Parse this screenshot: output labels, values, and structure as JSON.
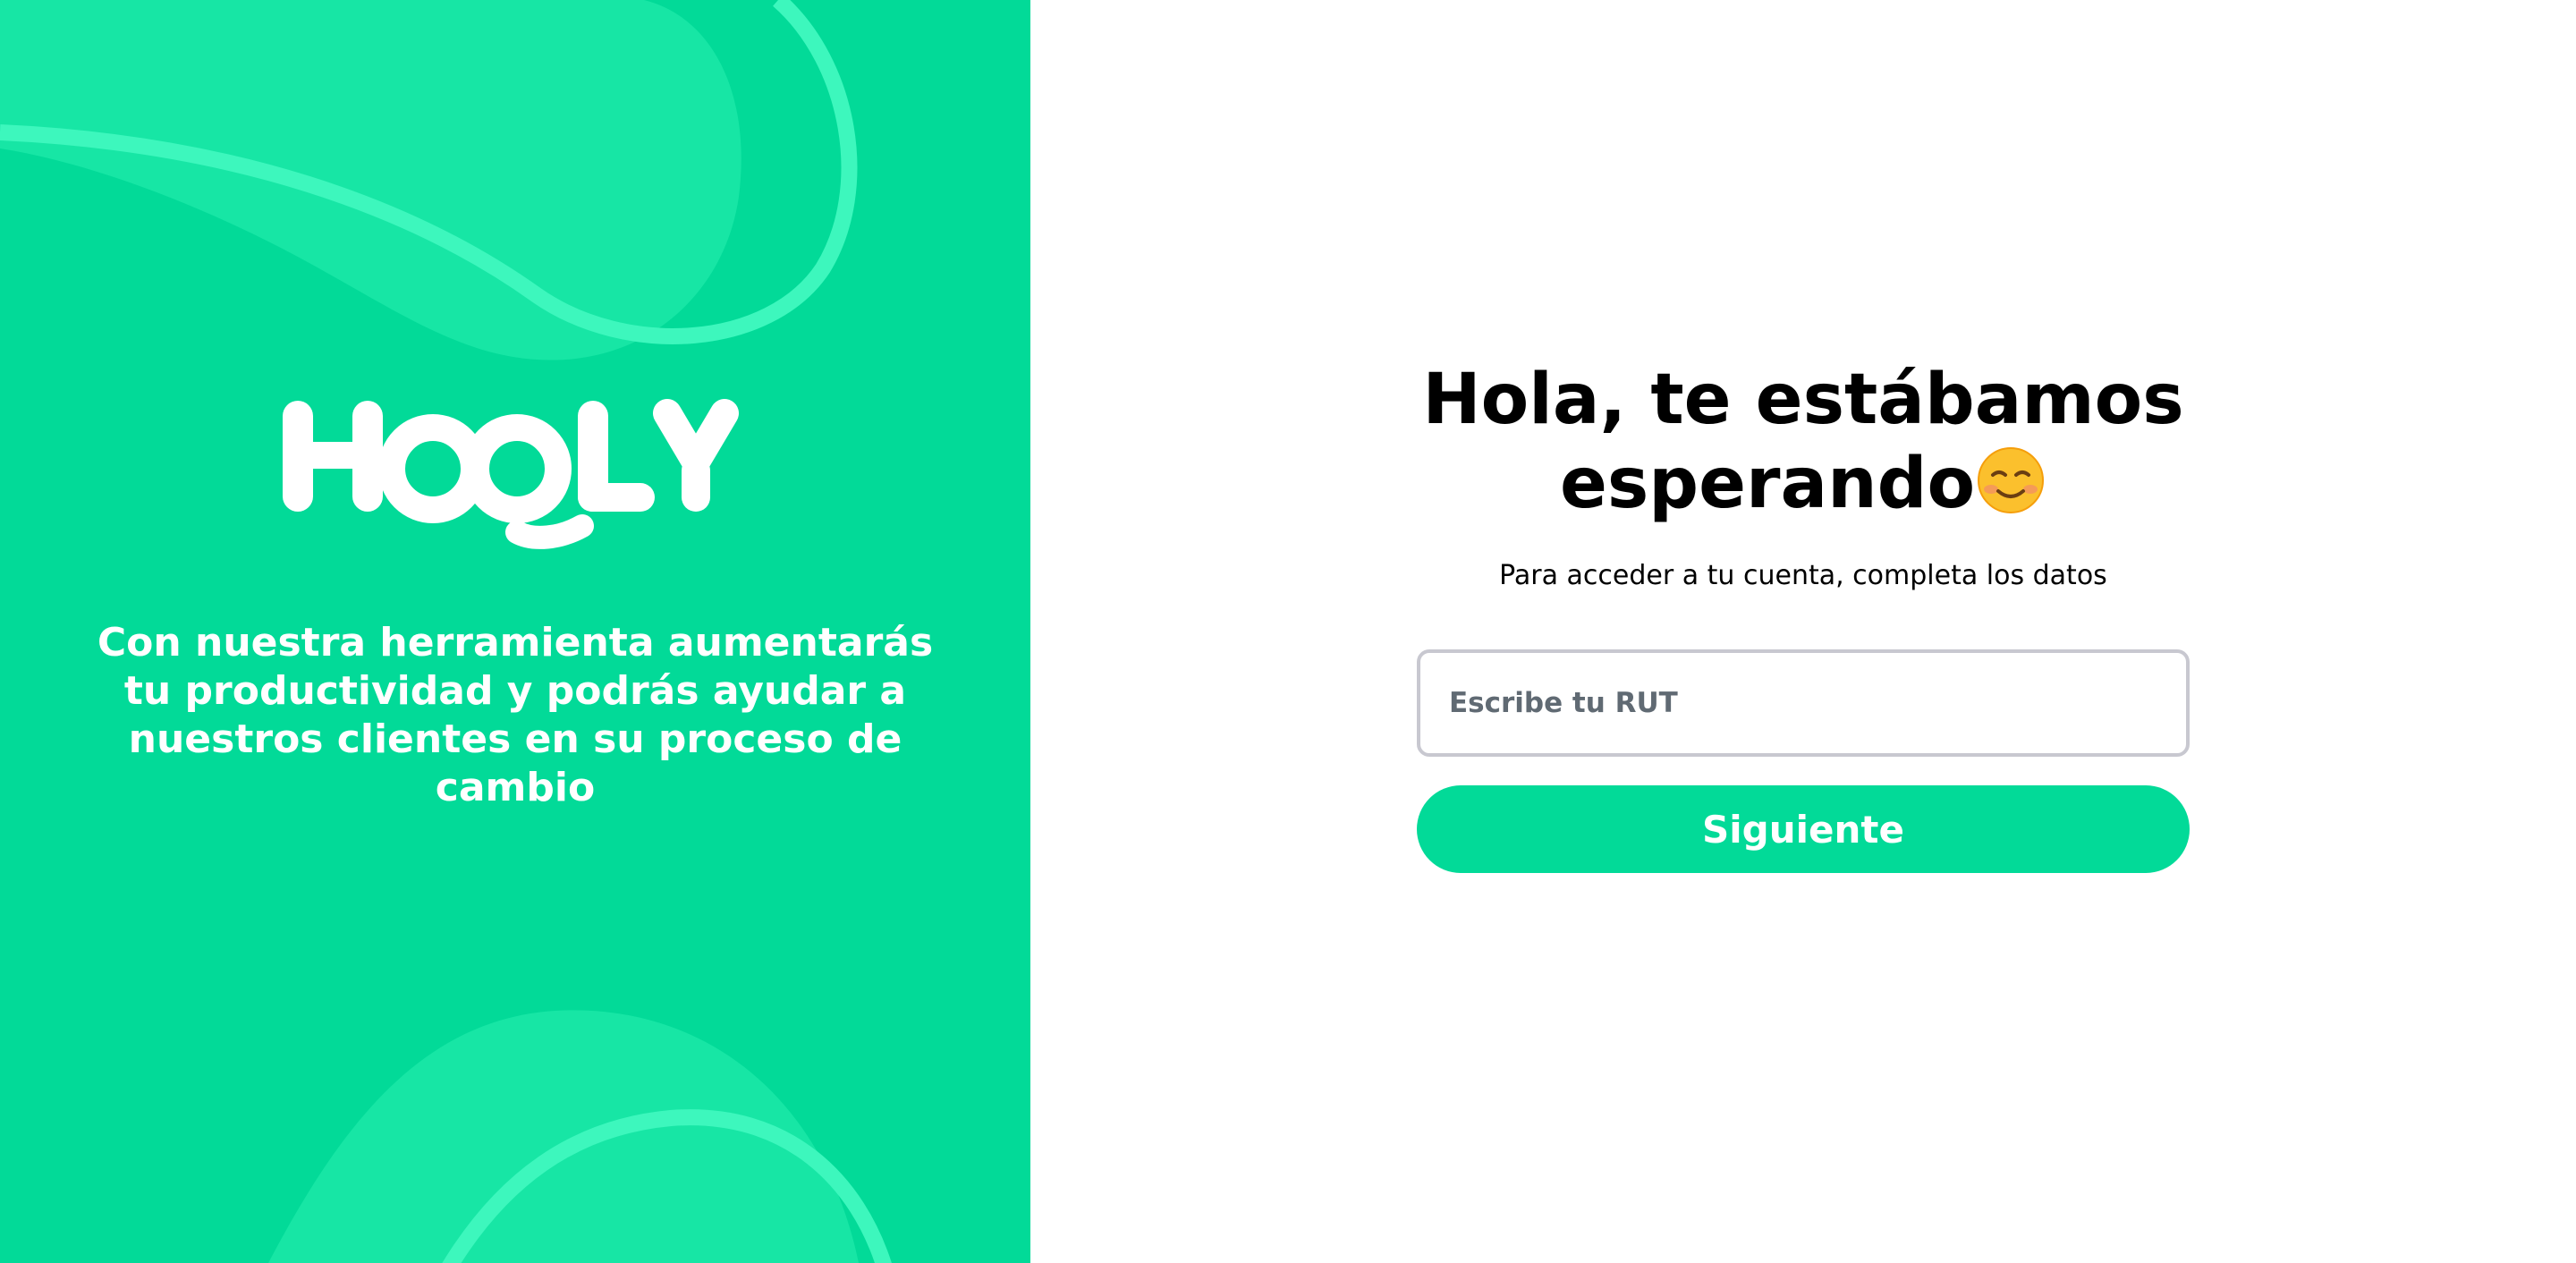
{
  "brand": {
    "logo_text": "HOOLY",
    "accent_color": "#02da98",
    "accent_light": "#17e6a5",
    "accent_stroke": "#3df7bd"
  },
  "left": {
    "tagline": "Con nuestra herramienta aumentarás tu productividad y podrás ayudar a nuestros clientes en su proceso de cambio"
  },
  "login": {
    "title_line1": "Hola, te estábamos",
    "title_line2": "esperando",
    "title_emoji": "smiling-face-icon",
    "subtitle": "Para acceder a tu cuenta, completa los datos",
    "rut_placeholder": "Escribe tu RUT",
    "rut_value": "",
    "next_label": "Siguiente"
  }
}
